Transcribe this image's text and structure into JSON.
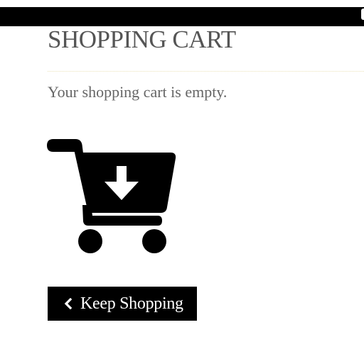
{
  "header": {
    "title": "SHOPPING CART"
  },
  "cart": {
    "empty_message": "Your shopping cart is empty."
  },
  "actions": {
    "keep_shopping_label": "Keep Shopping"
  },
  "icons": {
    "cart": "cart-download-icon",
    "back": "chevron-left-icon"
  },
  "colors": {
    "top_bar": "#000000",
    "title": "#555555",
    "text": "#666666",
    "divider": "#ece3b8",
    "button_bg": "#000000",
    "button_text": "#ffffff"
  }
}
